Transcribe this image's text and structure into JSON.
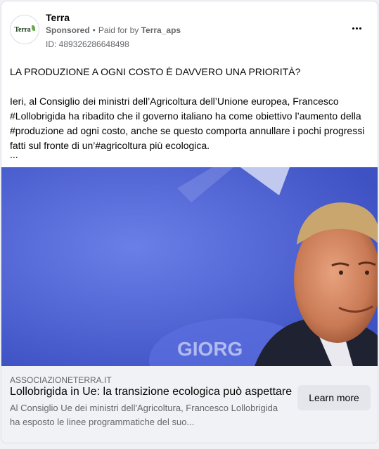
{
  "header": {
    "page_name": "Terra",
    "avatar_text": "Terra",
    "sponsored": "Sponsored",
    "separator": "•",
    "paid_for_by_prefix": "Paid for by",
    "paid_for_by_name": "Terra_aps",
    "ad_id": "ID: 489326286648498"
  },
  "post": {
    "headline": "LA PRODUZIONE A OGNI COSTO È DAVVERO UNA PRIORITÀ?",
    "body": "Ieri, al Consiglio dei ministri dell’Agricoltura dell’Unione europea, Francesco #Lollobrigida ha ribadito che il governo italiano ha come obiettivo l’aumento della #produzione ad ogni costo, anche se questo comporta annullare i pochi progressi fatti sul fronte di un’#agricoltura più ecologica.",
    "see_more": "..."
  },
  "link_preview": {
    "domain": "ASSOCIAZIONETERRA.IT",
    "title": "Lollobrigida in Ue: la transizione ecologica può aspettare",
    "description": "Al Consiglio Ue dei ministri dell'Agricoltura, Francesco Lollobrigida ha esposto le linee programmatiche del suo...",
    "cta_label": "Learn more"
  },
  "image": {
    "backdrop_text": "GIORG"
  },
  "colors": {
    "background": "#f0f2f5",
    "card": "#ffffff",
    "secondary_text": "#65676b",
    "button_bg": "#e4e6eb",
    "image_blue": "#4a5fd2"
  },
  "icons": {
    "more": "more-horizontal-icon"
  }
}
